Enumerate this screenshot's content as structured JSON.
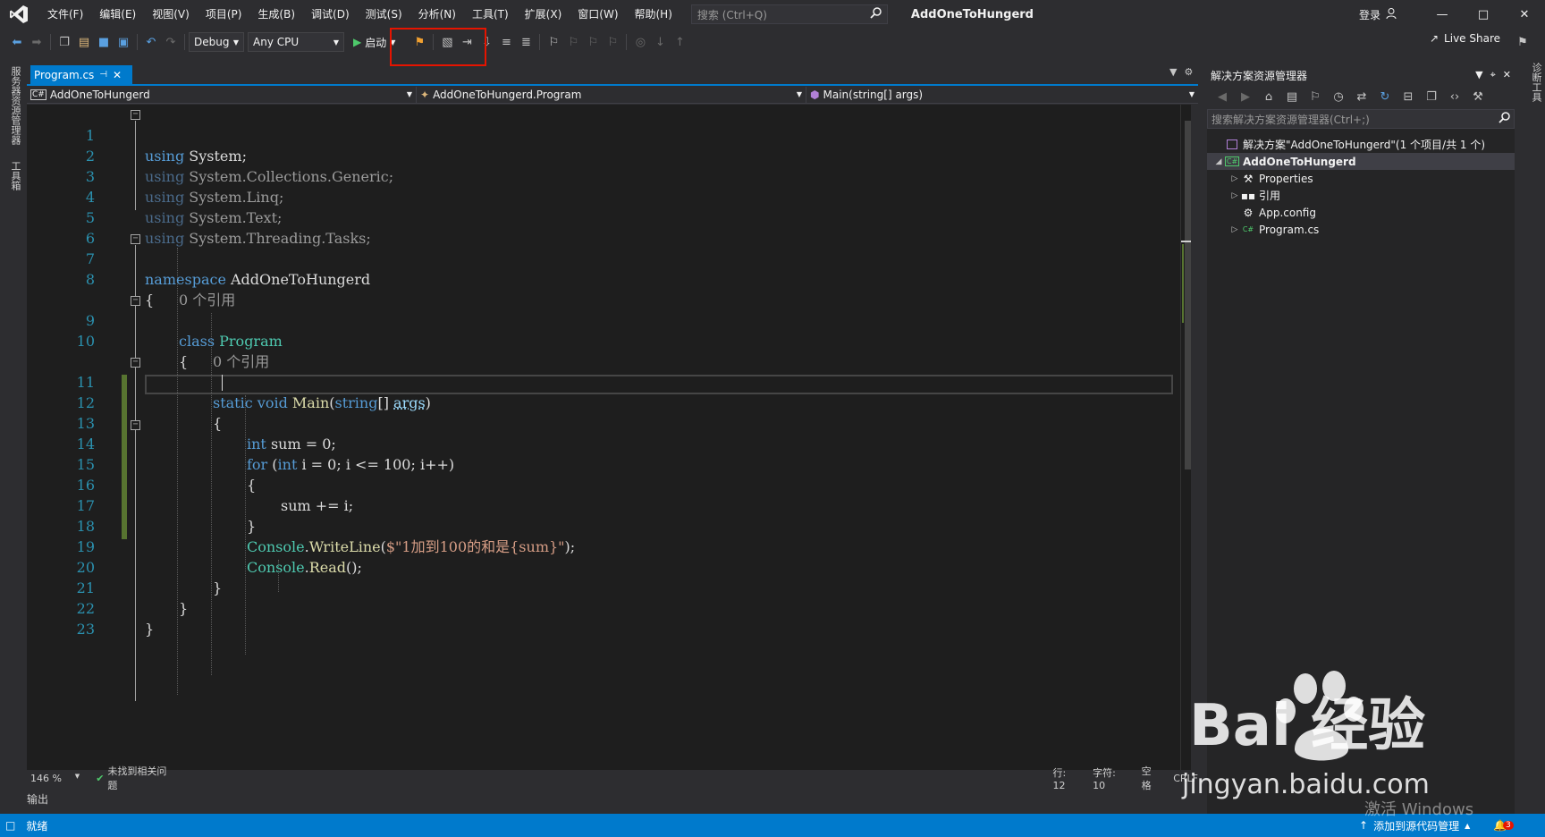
{
  "menu": [
    "文件(F)",
    "编辑(E)",
    "视图(V)",
    "项目(P)",
    "生成(B)",
    "调试(D)",
    "测试(S)",
    "分析(N)",
    "工具(T)",
    "扩展(X)",
    "窗口(W)",
    "帮助(H)"
  ],
  "search": {
    "placeholder": "搜索 (Ctrl+Q)"
  },
  "window_title": "AddOneToHungerd",
  "login": "登录",
  "toolbar": {
    "config": "Debug",
    "platform": "Any CPU",
    "start_label": "启动",
    "live_share": "Live Share"
  },
  "left_rail": {
    "server_explorer": "服务器资源管理器",
    "toolbox": "工具箱"
  },
  "right_rail": {
    "diagnostics": "诊断工具"
  },
  "doc_tab": {
    "name": "Program.cs",
    "pin": "⊣"
  },
  "nav": {
    "project": "AddOneToHungerd",
    "class": "AddOneToHungerd.Program",
    "member": "Main(string[] args)"
  },
  "lens": {
    "refs": "0 个引用"
  },
  "code_lines": {
    "l1": "System;",
    "l2": "System.Collections.Generic;",
    "l3": "System.Linq;",
    "l4": "System.Text;",
    "l5": "System.Threading.Tasks;",
    "kw_using": "using",
    "kw_namespace": "namespace",
    "ns_name": "AddOneToHungerd",
    "brace_open": "{",
    "brace_close": "}",
    "kw_class": "class",
    "class_name": "Program",
    "kw_static": "static",
    "kw_void": "void",
    "main": "Main",
    "kw_string": "string",
    "main_args": "[] ",
    "args": "args",
    "paren_close": ")",
    "kw_int": "int",
    "sum_init": " sum = 0;",
    "kw_for": "for",
    "for_open": " (",
    "for_rest": " i = 0; i <= 100; i++)",
    "sum_add": "sum += i;",
    "console": "Console",
    "writeline": "WriteLine",
    "str": "$\"1加到100的和是{sum}\"",
    "wl_end": ");",
    "read": "Read",
    "read_end": "();",
    "dot": ".",
    "paren_open": "("
  },
  "line_numbers": [
    "1",
    "2",
    "3",
    "4",
    "5",
    "6",
    "7",
    "8",
    "9",
    "10",
    "11",
    "12",
    "13",
    "14",
    "15",
    "16",
    "17",
    "18",
    "19",
    "20",
    "21",
    "22",
    "23"
  ],
  "status_line": {
    "zoom": "146 %",
    "issues": "未找到相关问题",
    "row": "行: 12",
    "col": "字符: 10",
    "ws": "空格",
    "eol": "CRLF"
  },
  "output_tab": "输出",
  "solution_explorer": {
    "title": "解决方案资源管理器",
    "search_placeholder": "搜索解决方案资源管理器(Ctrl+;)",
    "items": [
      {
        "label": "解决方案\"AddOneToHungerd\"(1 个项目/共 1 个)"
      },
      {
        "label": "AddOneToHungerd"
      },
      {
        "label": "Properties"
      },
      {
        "label": "引用"
      },
      {
        "label": "App.config"
      },
      {
        "label": "Program.cs"
      }
    ]
  },
  "bottom_status": {
    "ready": "就绪",
    "add_source": "添加到源代码管理",
    "notif_count": "3"
  },
  "watermark": {
    "brand": "Bai  经验",
    "url": "jingyan.baidu.com",
    "activate": "激活 Windows"
  },
  "colors": {
    "accent": "#007acc",
    "keyword": "#569cd6",
    "type": "#4ec9b0",
    "method": "#dcdcaa",
    "string": "#d69d85",
    "line_number": "#2b91af",
    "highlight_box": "#e51400"
  }
}
